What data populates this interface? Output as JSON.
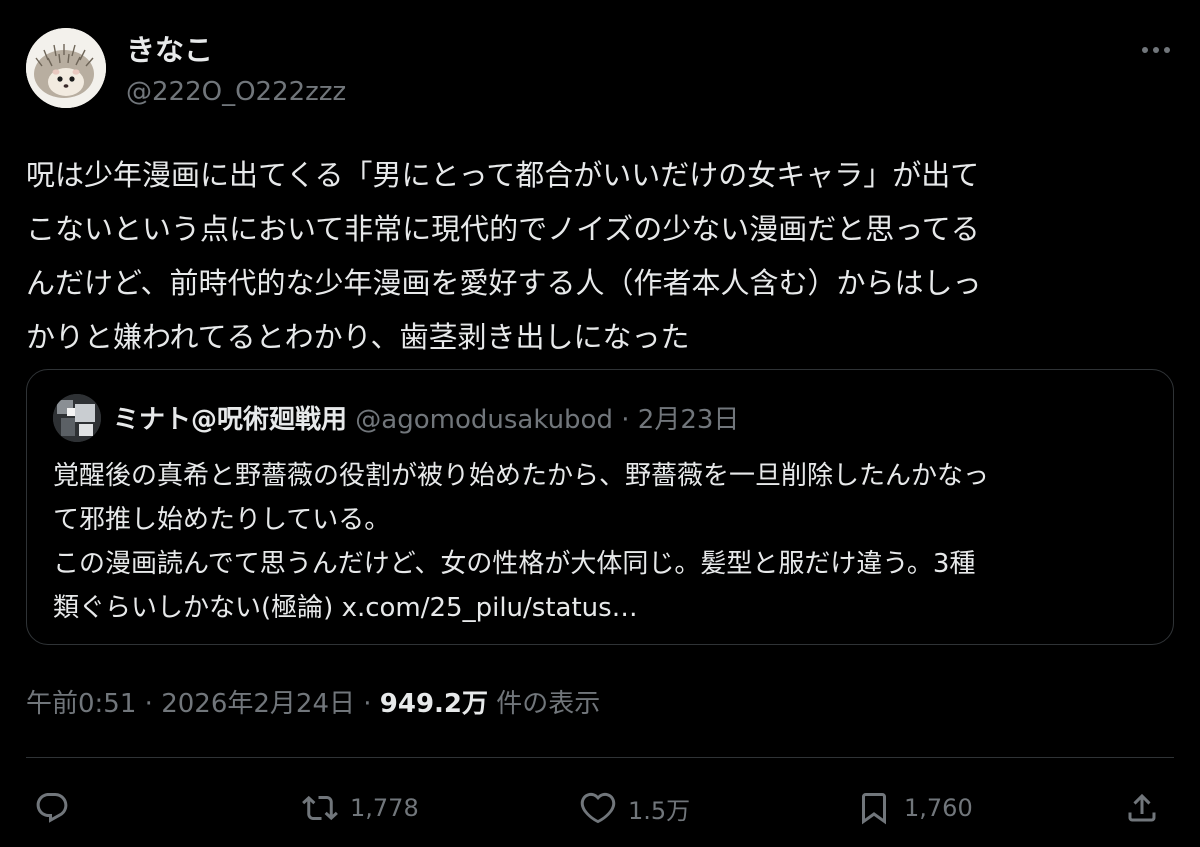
{
  "author": {
    "display_name": "きなこ",
    "handle": "@222O_O222zzz",
    "avatar_icon": "hedgehog-avatar"
  },
  "tweet": {
    "text": "呪は少年漫画に出てくる「男にとって都合がいいだけの女キャラ」が出て\nこないという点において非常に現代的でノイズの少ない漫画だと思ってる\nんだけど、前時代的な少年漫画を愛好する人（作者本人含む）からはしっ\nかりと嫌われてるとわかり、歯茎剥き出しになった"
  },
  "quote": {
    "display_name": "ミナト@呪術廻戦用",
    "handle": "@agomodusakubod",
    "separator": "·",
    "date": "2月23日",
    "text": "覚醒後の真希と野薔薇の役割が被り始めたから、野薔薇を一旦削除したんかなっ\nて邪推し始めたりしている。\nこの漫画読んでて思うんだけど、女の性格が大体同じ。髪型と服だけ違う。3種\n類ぐらいしかない(極論) ",
    "link": "x.com/25_pilu/status…"
  },
  "meta": {
    "time": "午前0:51",
    "sep1": "·",
    "date": "2026年2月24日",
    "sep2": "·",
    "views_count": "949.2万",
    "views_label": " 件の表示"
  },
  "actions": {
    "reply_icon": "reply-icon",
    "retweet_icon": "retweet-icon",
    "retweet_count": "1,778",
    "like_icon": "heart-icon",
    "like_count": "1.5万",
    "bookmark_icon": "bookmark-icon",
    "bookmark_count": "1,760",
    "share_icon": "share-icon"
  },
  "colors": {
    "background": "#000000",
    "primary_text": "#e7e9ea",
    "secondary_text": "#71767b",
    "border": "#2f3336"
  }
}
